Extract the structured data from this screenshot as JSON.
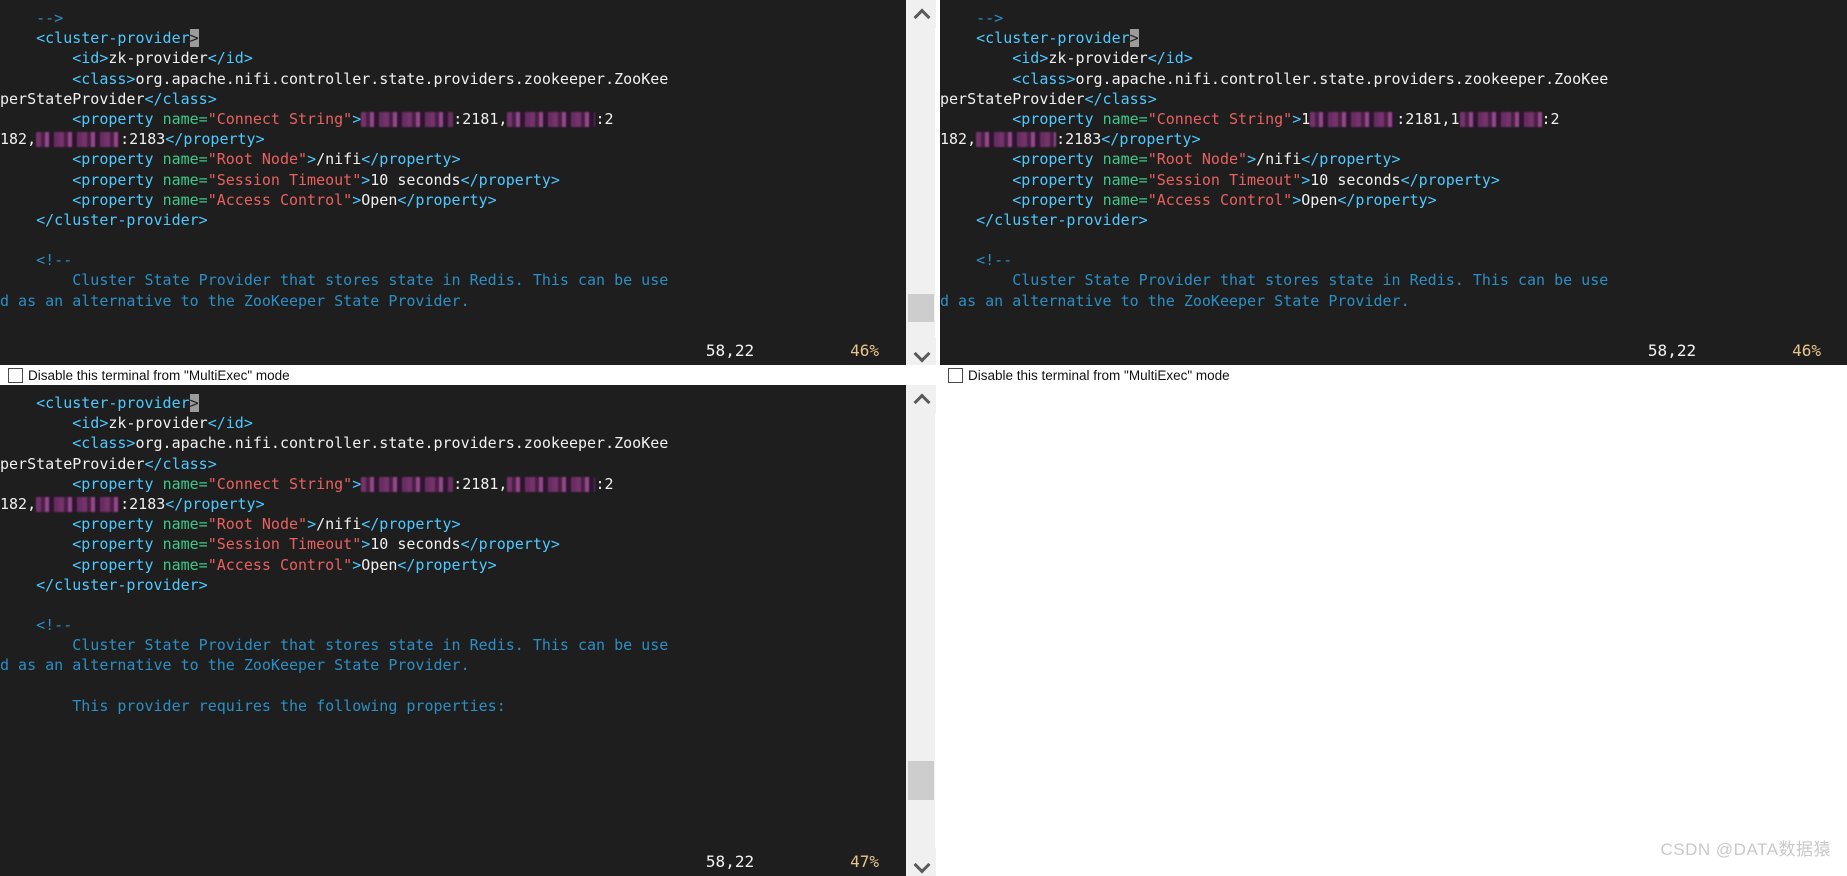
{
  "app": {
    "type": "multi-terminal-ssh-client",
    "watermark": "CSDN @DATA数据猿"
  },
  "checkbox": {
    "label": "Disable this terminal from \"MultiExec\" mode",
    "checked": false
  },
  "icons": {
    "scroll_up": "chevron-up-icon",
    "scroll_down": "chevron-down-icon"
  },
  "colors": {
    "terminal_bg": "#1e1e1e",
    "tag": "#4ec9ff",
    "attribute_name": "#3ec98a",
    "attribute_value": "#e8615f",
    "comment": "#2b8fc6",
    "plain_text": "#f0f0f0",
    "cursor": "#9b9b9b",
    "redaction": "#7b3470",
    "status_position": "#f2f2f2",
    "status_percent": "#e8c48a",
    "scrollbar_track": "#f0f0f0",
    "scrollbar_thumb": "#cdcdcd"
  },
  "panels": {
    "top_left": {
      "name": "terminal-top-left",
      "status": {
        "position": "58,22",
        "percent": "46%"
      },
      "scrollbar": {
        "visible": true,
        "thumb_top_pct": 86,
        "thumb_height_pct": 9
      },
      "lines": [
        {
          "segments": [
            {
              "t": "    ",
              "c": "txt"
            },
            {
              "t": "-->",
              "c": "cmt"
            }
          ]
        },
        {
          "segments": [
            {
              "t": "    ",
              "c": "txt"
            },
            {
              "t": "<cluster-provider",
              "c": "tagname"
            },
            {
              "t": ">",
              "c": "cursor"
            }
          ]
        },
        {
          "segments": [
            {
              "t": "        ",
              "c": "txt"
            },
            {
              "t": "<id>",
              "c": "tagname"
            },
            {
              "t": "zk-provider",
              "c": "txt"
            },
            {
              "t": "</id>",
              "c": "tagname"
            }
          ]
        },
        {
          "segments": [
            {
              "t": "        ",
              "c": "txt"
            },
            {
              "t": "<class>",
              "c": "tagname"
            },
            {
              "t": "org.apache.nifi.controller.state.providers.zookeeper.ZooKee",
              "c": "txt"
            }
          ]
        },
        {
          "segments": [
            {
              "t": "perStateProvider",
              "c": "txt"
            },
            {
              "t": "</class>",
              "c": "tagname"
            }
          ]
        },
        {
          "segments": [
            {
              "t": "        ",
              "c": "txt"
            },
            {
              "t": "<property ",
              "c": "tagname"
            },
            {
              "t": "name=",
              "c": "attr"
            },
            {
              "t": "\"Connect String\"",
              "c": "val"
            },
            {
              "t": ">",
              "c": "tagname"
            },
            {
              "t": "REDACT:92",
              "c": "redact"
            },
            {
              "t": ":2181,",
              "c": "txt"
            },
            {
              "t": "REDACT:88",
              "c": "redact"
            },
            {
              "t": ":2",
              "c": "txt"
            }
          ]
        },
        {
          "segments": [
            {
              "t": "182,",
              "c": "txt"
            },
            {
              "t": "REDACT:84",
              "c": "redact"
            },
            {
              "t": ":2183",
              "c": "txt"
            },
            {
              "t": "</property>",
              "c": "tagname"
            }
          ]
        },
        {
          "segments": [
            {
              "t": "        ",
              "c": "txt"
            },
            {
              "t": "<property ",
              "c": "tagname"
            },
            {
              "t": "name=",
              "c": "attr"
            },
            {
              "t": "\"Root Node\"",
              "c": "val"
            },
            {
              "t": ">",
              "c": "tagname"
            },
            {
              "t": "/nifi",
              "c": "txt"
            },
            {
              "t": "</property>",
              "c": "tagname"
            }
          ]
        },
        {
          "segments": [
            {
              "t": "        ",
              "c": "txt"
            },
            {
              "t": "<property ",
              "c": "tagname"
            },
            {
              "t": "name=",
              "c": "attr"
            },
            {
              "t": "\"Session Timeout\"",
              "c": "val"
            },
            {
              "t": ">",
              "c": "tagname"
            },
            {
              "t": "10 seconds",
              "c": "txt"
            },
            {
              "t": "</property>",
              "c": "tagname"
            }
          ]
        },
        {
          "segments": [
            {
              "t": "        ",
              "c": "txt"
            },
            {
              "t": "<property ",
              "c": "tagname"
            },
            {
              "t": "name=",
              "c": "attr"
            },
            {
              "t": "\"Access Control\"",
              "c": "val"
            },
            {
              "t": ">",
              "c": "tagname"
            },
            {
              "t": "Open",
              "c": "txt"
            },
            {
              "t": "</property>",
              "c": "tagname"
            }
          ]
        },
        {
          "segments": [
            {
              "t": "    ",
              "c": "txt"
            },
            {
              "t": "</cluster-provider>",
              "c": "tagname"
            }
          ]
        },
        {
          "segments": [
            {
              "t": "",
              "c": "txt"
            }
          ]
        },
        {
          "segments": [
            {
              "t": "    ",
              "c": "txt"
            },
            {
              "t": "<!--",
              "c": "cmt"
            }
          ]
        },
        {
          "segments": [
            {
              "t": "        Cluster State Provider that stores state in Redis. This can be use",
              "c": "cmt"
            }
          ]
        },
        {
          "segments": [
            {
              "t": "d as an alternative to the ZooKeeper State Provider.",
              "c": "cmt"
            }
          ]
        }
      ]
    },
    "top_right": {
      "name": "terminal-top-right",
      "status": {
        "position": "58,22",
        "percent": "46%"
      },
      "scrollbar": {
        "visible": false
      },
      "lines": [
        {
          "segments": [
            {
              "t": "    ",
              "c": "txt"
            },
            {
              "t": "-->",
              "c": "cmt"
            }
          ]
        },
        {
          "segments": [
            {
              "t": "    ",
              "c": "txt"
            },
            {
              "t": "<cluster-provider",
              "c": "tagname"
            },
            {
              "t": ">",
              "c": "cursor"
            }
          ]
        },
        {
          "segments": [
            {
              "t": "        ",
              "c": "txt"
            },
            {
              "t": "<id>",
              "c": "tagname"
            },
            {
              "t": "zk-provider",
              "c": "txt"
            },
            {
              "t": "</id>",
              "c": "tagname"
            }
          ]
        },
        {
          "segments": [
            {
              "t": "        ",
              "c": "txt"
            },
            {
              "t": "<class>",
              "c": "tagname"
            },
            {
              "t": "org.apache.nifi.controller.state.providers.zookeeper.ZooKee",
              "c": "txt"
            }
          ]
        },
        {
          "segments": [
            {
              "t": "perStateProvider",
              "c": "txt"
            },
            {
              "t": "</class>",
              "c": "tagname"
            }
          ]
        },
        {
          "segments": [
            {
              "t": "        ",
              "c": "txt"
            },
            {
              "t": "<property ",
              "c": "tagname"
            },
            {
              "t": "name=",
              "c": "attr"
            },
            {
              "t": "\"Connect String\"",
              "c": "val"
            },
            {
              "t": ">",
              "c": "tagname"
            },
            {
              "t": "1",
              "c": "txt"
            },
            {
              "t": "REDACT:86",
              "c": "redact"
            },
            {
              "t": ":2181,",
              "c": "txt"
            },
            {
              "t": "1",
              "c": "txt"
            },
            {
              "t": "REDACT:82",
              "c": "redact"
            },
            {
              "t": ":2",
              "c": "txt"
            }
          ]
        },
        {
          "segments": [
            {
              "t": "182,",
              "c": "txt"
            },
            {
              "t": "REDACT:80",
              "c": "redact"
            },
            {
              "t": ":2183",
              "c": "txt"
            },
            {
              "t": "</property>",
              "c": "tagname"
            }
          ]
        },
        {
          "segments": [
            {
              "t": "        ",
              "c": "txt"
            },
            {
              "t": "<property ",
              "c": "tagname"
            },
            {
              "t": "name=",
              "c": "attr"
            },
            {
              "t": "\"Root Node\"",
              "c": "val"
            },
            {
              "t": ">",
              "c": "tagname"
            },
            {
              "t": "/nifi",
              "c": "txt"
            },
            {
              "t": "</property>",
              "c": "tagname"
            }
          ]
        },
        {
          "segments": [
            {
              "t": "        ",
              "c": "txt"
            },
            {
              "t": "<property ",
              "c": "tagname"
            },
            {
              "t": "name=",
              "c": "attr"
            },
            {
              "t": "\"Session Timeout\"",
              "c": "val"
            },
            {
              "t": ">",
              "c": "tagname"
            },
            {
              "t": "10 seconds",
              "c": "txt"
            },
            {
              "t": "</property>",
              "c": "tagname"
            }
          ]
        },
        {
          "segments": [
            {
              "t": "        ",
              "c": "txt"
            },
            {
              "t": "<property ",
              "c": "tagname"
            },
            {
              "t": "name=",
              "c": "attr"
            },
            {
              "t": "\"Access Control\"",
              "c": "val"
            },
            {
              "t": ">",
              "c": "tagname"
            },
            {
              "t": "Open",
              "c": "txt"
            },
            {
              "t": "</property>",
              "c": "tagname"
            }
          ]
        },
        {
          "segments": [
            {
              "t": "    ",
              "c": "txt"
            },
            {
              "t": "</cluster-provider>",
              "c": "tagname"
            }
          ]
        },
        {
          "segments": [
            {
              "t": "",
              "c": "txt"
            }
          ]
        },
        {
          "segments": [
            {
              "t": "    ",
              "c": "txt"
            },
            {
              "t": "<!--",
              "c": "cmt"
            }
          ]
        },
        {
          "segments": [
            {
              "t": "        Cluster State Provider that stores state in Redis. This can be use",
              "c": "cmt"
            }
          ]
        },
        {
          "segments": [
            {
              "t": "d as an alternative to the ZooKeeper State Provider.",
              "c": "cmt"
            }
          ]
        }
      ]
    },
    "bottom_left": {
      "name": "terminal-bottom-left",
      "status": {
        "position": "58,22",
        "percent": "47%"
      },
      "scrollbar": {
        "visible": true,
        "thumb_top_pct": 80,
        "thumb_height_pct": 9
      },
      "lines": [
        {
          "segments": [
            {
              "t": "    ",
              "c": "txt"
            },
            {
              "t": "<cluster-provider",
              "c": "tagname"
            },
            {
              "t": ">",
              "c": "cursor"
            }
          ]
        },
        {
          "segments": [
            {
              "t": "        ",
              "c": "txt"
            },
            {
              "t": "<id>",
              "c": "tagname"
            },
            {
              "t": "zk-provider",
              "c": "txt"
            },
            {
              "t": "</id>",
              "c": "tagname"
            }
          ]
        },
        {
          "segments": [
            {
              "t": "        ",
              "c": "txt"
            },
            {
              "t": "<class>",
              "c": "tagname"
            },
            {
              "t": "org.apache.nifi.controller.state.providers.zookeeper.ZooKee",
              "c": "txt"
            }
          ]
        },
        {
          "segments": [
            {
              "t": "perStateProvider",
              "c": "txt"
            },
            {
              "t": "</class>",
              "c": "tagname"
            }
          ]
        },
        {
          "segments": [
            {
              "t": "        ",
              "c": "txt"
            },
            {
              "t": "<property ",
              "c": "tagname"
            },
            {
              "t": "name=",
              "c": "attr"
            },
            {
              "t": "\"Connect String\"",
              "c": "val"
            },
            {
              "t": ">",
              "c": "tagname"
            },
            {
              "t": "REDACT:92",
              "c": "redact"
            },
            {
              "t": ":2181,",
              "c": "txt"
            },
            {
              "t": "REDACT:88",
              "c": "redact"
            },
            {
              "t": ":2",
              "c": "txt"
            }
          ]
        },
        {
          "segments": [
            {
              "t": "182,",
              "c": "txt"
            },
            {
              "t": "REDACT:84",
              "c": "redact"
            },
            {
              "t": ":2183",
              "c": "txt"
            },
            {
              "t": "</property>",
              "c": "tagname"
            }
          ]
        },
        {
          "segments": [
            {
              "t": "        ",
              "c": "txt"
            },
            {
              "t": "<property ",
              "c": "tagname"
            },
            {
              "t": "name=",
              "c": "attr"
            },
            {
              "t": "\"Root Node\"",
              "c": "val"
            },
            {
              "t": ">",
              "c": "tagname"
            },
            {
              "t": "/nifi",
              "c": "txt"
            },
            {
              "t": "</property>",
              "c": "tagname"
            }
          ]
        },
        {
          "segments": [
            {
              "t": "        ",
              "c": "txt"
            },
            {
              "t": "<property ",
              "c": "tagname"
            },
            {
              "t": "name=",
              "c": "attr"
            },
            {
              "t": "\"Session Timeout\"",
              "c": "val"
            },
            {
              "t": ">",
              "c": "tagname"
            },
            {
              "t": "10 seconds",
              "c": "txt"
            },
            {
              "t": "</property>",
              "c": "tagname"
            }
          ]
        },
        {
          "segments": [
            {
              "t": "        ",
              "c": "txt"
            },
            {
              "t": "<property ",
              "c": "tagname"
            },
            {
              "t": "name=",
              "c": "attr"
            },
            {
              "t": "\"Access Control\"",
              "c": "val"
            },
            {
              "t": ">",
              "c": "tagname"
            },
            {
              "t": "Open",
              "c": "txt"
            },
            {
              "t": "</property>",
              "c": "tagname"
            }
          ]
        },
        {
          "segments": [
            {
              "t": "    ",
              "c": "txt"
            },
            {
              "t": "</cluster-provider>",
              "c": "tagname"
            }
          ]
        },
        {
          "segments": [
            {
              "t": "",
              "c": "txt"
            }
          ]
        },
        {
          "segments": [
            {
              "t": "    ",
              "c": "txt"
            },
            {
              "t": "<!--",
              "c": "cmt"
            }
          ]
        },
        {
          "segments": [
            {
              "t": "        Cluster State Provider that stores state in Redis. This can be use",
              "c": "cmt"
            }
          ]
        },
        {
          "segments": [
            {
              "t": "d as an alternative to the ZooKeeper State Provider.",
              "c": "cmt"
            }
          ]
        },
        {
          "segments": [
            {
              "t": "",
              "c": "txt"
            }
          ]
        },
        {
          "segments": [
            {
              "t": "        This provider requires the following properties:",
              "c": "cmt"
            }
          ]
        }
      ]
    },
    "bottom_right": {
      "name": "empty-panel-bottom-right",
      "empty": true
    }
  }
}
